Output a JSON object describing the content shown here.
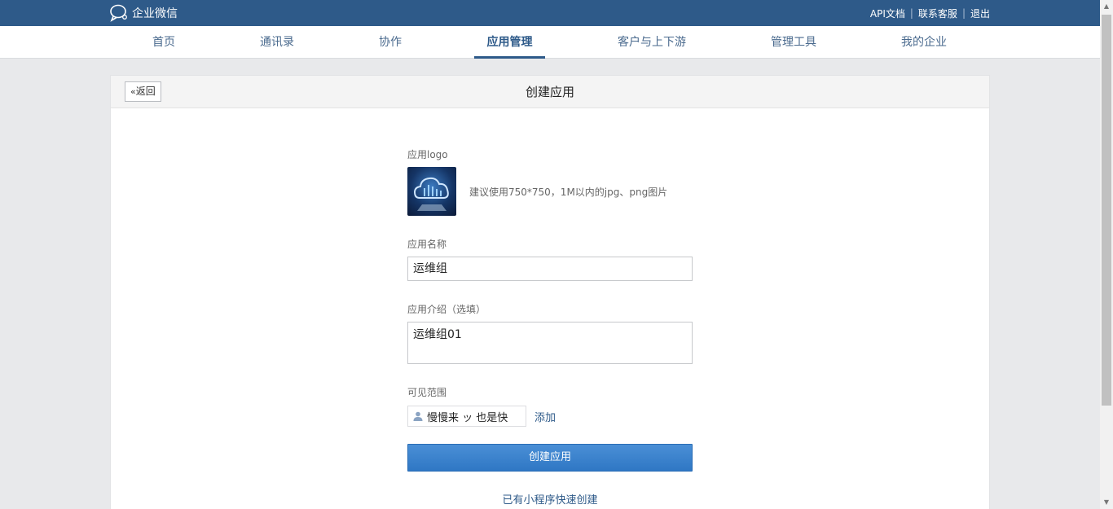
{
  "header": {
    "brand_name": "企业微信",
    "links": [
      "API文档",
      "联系客服",
      "退出"
    ],
    "bg_color": "#2e5a89"
  },
  "nav": {
    "items": [
      "首页",
      "通讯录",
      "协作",
      "应用管理",
      "客户与上下游",
      "管理工具",
      "我的企业"
    ],
    "active": "应用管理"
  },
  "card": {
    "back_label": "返回",
    "title": "创建应用"
  },
  "form": {
    "logo_label": "应用logo",
    "logo_hint": "建议使用750*750，1M以内的jpg、png图片",
    "name_label": "应用名称",
    "name_value": "运维组",
    "intro_label": "应用介绍（选填）",
    "intro_value": "运维组01",
    "visibility_label": "可见范围",
    "member_name": "慢慢来 ッ 也是快",
    "add_label": "添加",
    "submit_label": "创建应用",
    "mini_program_link": "已有小程序快速创建"
  },
  "icons": [
    "chat-bubble-icon",
    "double-chevron-left-icon",
    "user-icon",
    "cloud-logo"
  ]
}
